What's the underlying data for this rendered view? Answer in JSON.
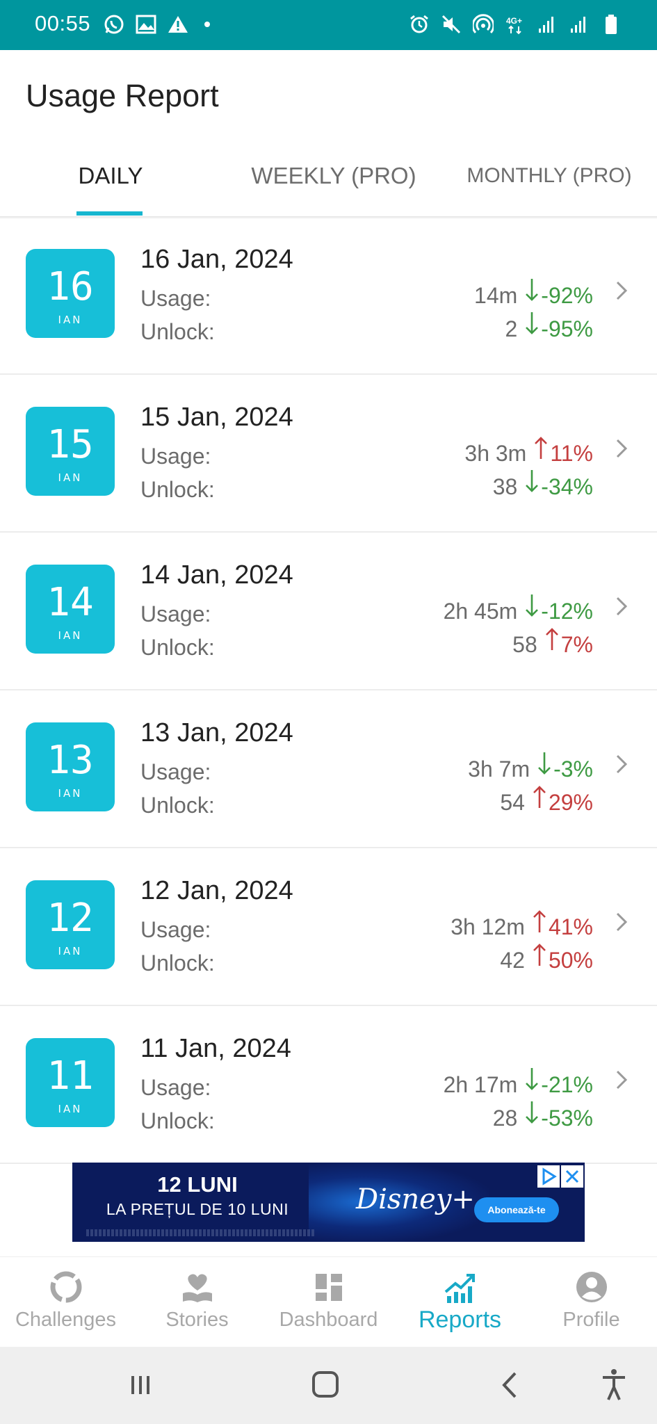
{
  "status_bar": {
    "time": "00:55",
    "left_icons": [
      "whatsapp-icon",
      "gallery-icon",
      "warning-icon",
      "dot"
    ],
    "right_icons": [
      "alarm-icon",
      "mute-icon",
      "hotspot-icon",
      "4g-icon",
      "signal-icon",
      "signal-icon",
      "battery-icon"
    ],
    "network": "4G+"
  },
  "header": {
    "title": "Usage Report",
    "tabs": [
      {
        "label": "DAILY",
        "active": true
      },
      {
        "label": "WEEKLY (PRO)",
        "active": false
      },
      {
        "label": "MONTHLY (PRO)",
        "active": false
      }
    ]
  },
  "labels": {
    "usage": "Usage:",
    "unlock": "Unlock:"
  },
  "reports": [
    {
      "day": "16",
      "month": "IAN",
      "date": "16 Jan, 2024",
      "usage": "14m",
      "usage_dir": "down",
      "usage_pct": "-92%",
      "unlock": "2",
      "unlock_dir": "down",
      "unlock_pct": "-95%"
    },
    {
      "day": "15",
      "month": "IAN",
      "date": "15 Jan, 2024",
      "usage": "3h 3m",
      "usage_dir": "up",
      "usage_pct": "11%",
      "unlock": "38",
      "unlock_dir": "down",
      "unlock_pct": "-34%"
    },
    {
      "day": "14",
      "month": "IAN",
      "date": "14 Jan, 2024",
      "usage": "2h 45m",
      "usage_dir": "down",
      "usage_pct": "-12%",
      "unlock": "58",
      "unlock_dir": "up",
      "unlock_pct": "7%"
    },
    {
      "day": "13",
      "month": "IAN",
      "date": "13 Jan, 2024",
      "usage": "3h 7m",
      "usage_dir": "down",
      "usage_pct": "-3%",
      "unlock": "54",
      "unlock_dir": "up",
      "unlock_pct": "29%"
    },
    {
      "day": "12",
      "month": "IAN",
      "date": "12 Jan, 2024",
      "usage": "3h 12m",
      "usage_dir": "up",
      "usage_pct": "41%",
      "unlock": "42",
      "unlock_dir": "up",
      "unlock_pct": "50%"
    },
    {
      "day": "11",
      "month": "IAN",
      "date": "11 Jan, 2024",
      "usage": "2h 17m",
      "usage_dir": "down",
      "usage_pct": "-21%",
      "unlock": "28",
      "unlock_dir": "down",
      "unlock_pct": "-53%"
    }
  ],
  "ad": {
    "line1": "12 LUNI",
    "line2": "LA PREȚUL DE 10 LUNI",
    "brand": "Disney+",
    "cta": "Abonează-te"
  },
  "bottom_nav": [
    {
      "label": "Challenges",
      "icon": "challenges-icon",
      "active": false
    },
    {
      "label": "Stories",
      "icon": "stories-icon",
      "active": false
    },
    {
      "label": "Dashboard",
      "icon": "dashboard-icon",
      "active": false
    },
    {
      "label": "Reports",
      "icon": "reports-icon",
      "active": true
    },
    {
      "label": "Profile",
      "icon": "profile-icon",
      "active": false
    }
  ],
  "colors": {
    "status_bar": "#00969e",
    "accent": "#17bfd8",
    "decrease": "#3e9a43",
    "increase": "#c43f3f"
  }
}
